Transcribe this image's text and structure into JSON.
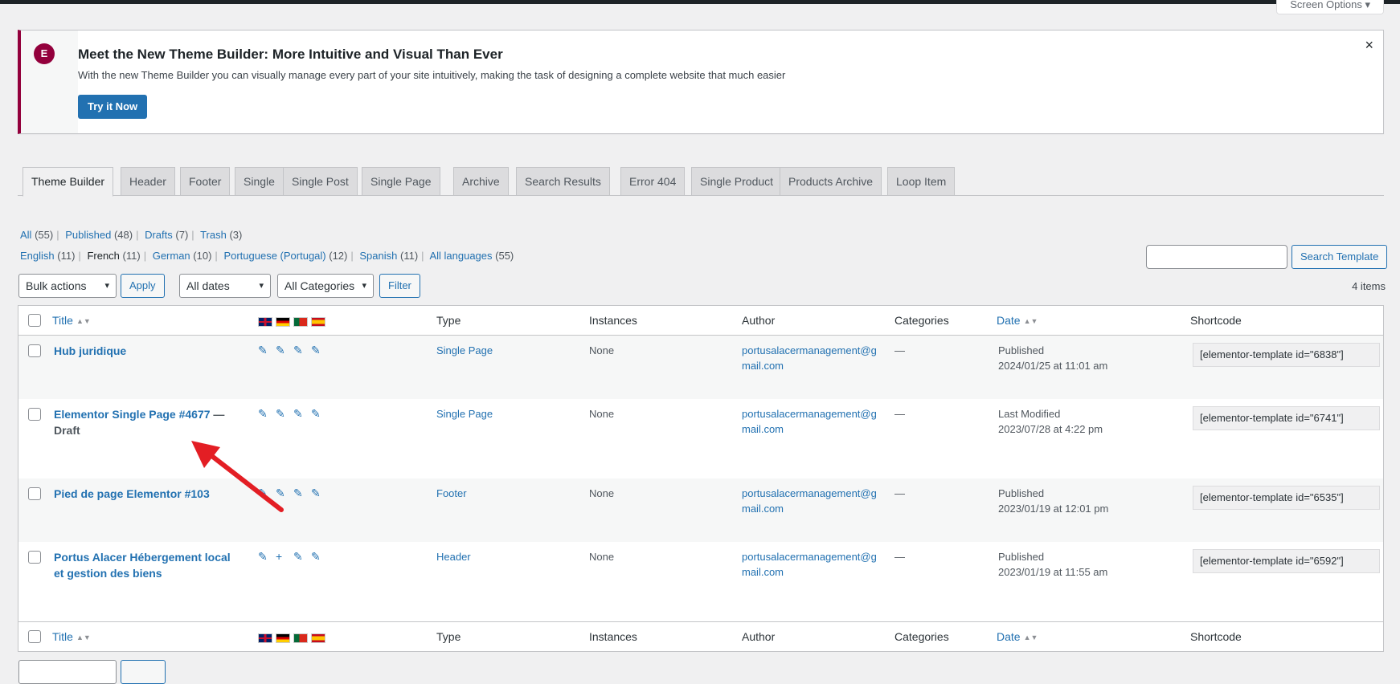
{
  "screen_options": "Screen Options",
  "notice": {
    "title": "Meet the New Theme Builder: More Intuitive and Visual Than Ever",
    "text": "With the new Theme Builder you can visually manage every part of your site intuitively, making the task of designing a complete website that much easier",
    "button": "Try it Now",
    "close": "×",
    "logo": "E"
  },
  "tabs": [
    "Theme Builder",
    "Header",
    "Footer",
    "Single",
    "Single Post",
    "Single Page",
    "Archive",
    "Search Results",
    "Error 404",
    "Single Product",
    "Products Archive",
    "Loop Item"
  ],
  "status_filters": [
    {
      "label": "All",
      "count": "(55)"
    },
    {
      "label": "Published",
      "count": "(48)"
    },
    {
      "label": "Drafts",
      "count": "(7)"
    },
    {
      "label": "Trash",
      "count": "(3)"
    }
  ],
  "language_filters": [
    {
      "label": "English",
      "count": "(11)"
    },
    {
      "label": "French",
      "count": "(11)"
    },
    {
      "label": "German",
      "count": "(10)"
    },
    {
      "label": "Portuguese (Portugal)",
      "count": "(12)"
    },
    {
      "label": "Spanish",
      "count": "(11)"
    },
    {
      "label": "All languages",
      "count": "(55)"
    }
  ],
  "search_button": "Search Template",
  "bulk_actions": "Bulk actions",
  "apply": "Apply",
  "all_dates": "All dates",
  "all_categories": "All Categories",
  "filter": "Filter",
  "items_count": "4 items",
  "columns": {
    "title": "Title",
    "type": "Type",
    "instances": "Instances",
    "author": "Author",
    "categories": "Categories",
    "date": "Date",
    "shortcode": "Shortcode"
  },
  "rows": [
    {
      "title": "Hub juridique",
      "state": "",
      "type": "Single Page",
      "instances": "None",
      "author": "portusalacermanagement@gmail.com",
      "categories": "—",
      "date_status": "Published",
      "date": "2024/01/25 at 11:01 am",
      "shortcode": "[elementor-template id=\"6838\"]"
    },
    {
      "title": "Elementor Single Page #4677",
      "state": "— Draft",
      "type": "Single Page",
      "instances": "None",
      "author": "portusalacermanagement@gmail.com",
      "categories": "—",
      "date_status": "Last Modified",
      "date": "2023/07/28 at 4:22 pm",
      "shortcode": "[elementor-template id=\"6741\"]"
    },
    {
      "title": "Pied de page Elementor #103",
      "state": "",
      "type": "Footer",
      "instances": "None",
      "author": "portusalacermanagement@gmail.com",
      "categories": "—",
      "date_status": "Published",
      "date": "2023/01/19 at 12:01 pm",
      "shortcode": "[elementor-template id=\"6535\"]"
    },
    {
      "title": "Portus Alacer Hébergement local et gestion des biens",
      "state": "",
      "type": "Header",
      "instances": "None",
      "author": "portusalacermanagement@gmail.com",
      "categories": "—",
      "date_status": "Published",
      "date": "2023/01/19 at 11:55 am",
      "shortcode": "[elementor-template id=\"6592\"]"
    }
  ],
  "edit_glyph": "✎",
  "add_glyph": "+",
  "sort_glyph": "▲▼",
  "chevron": "▾"
}
